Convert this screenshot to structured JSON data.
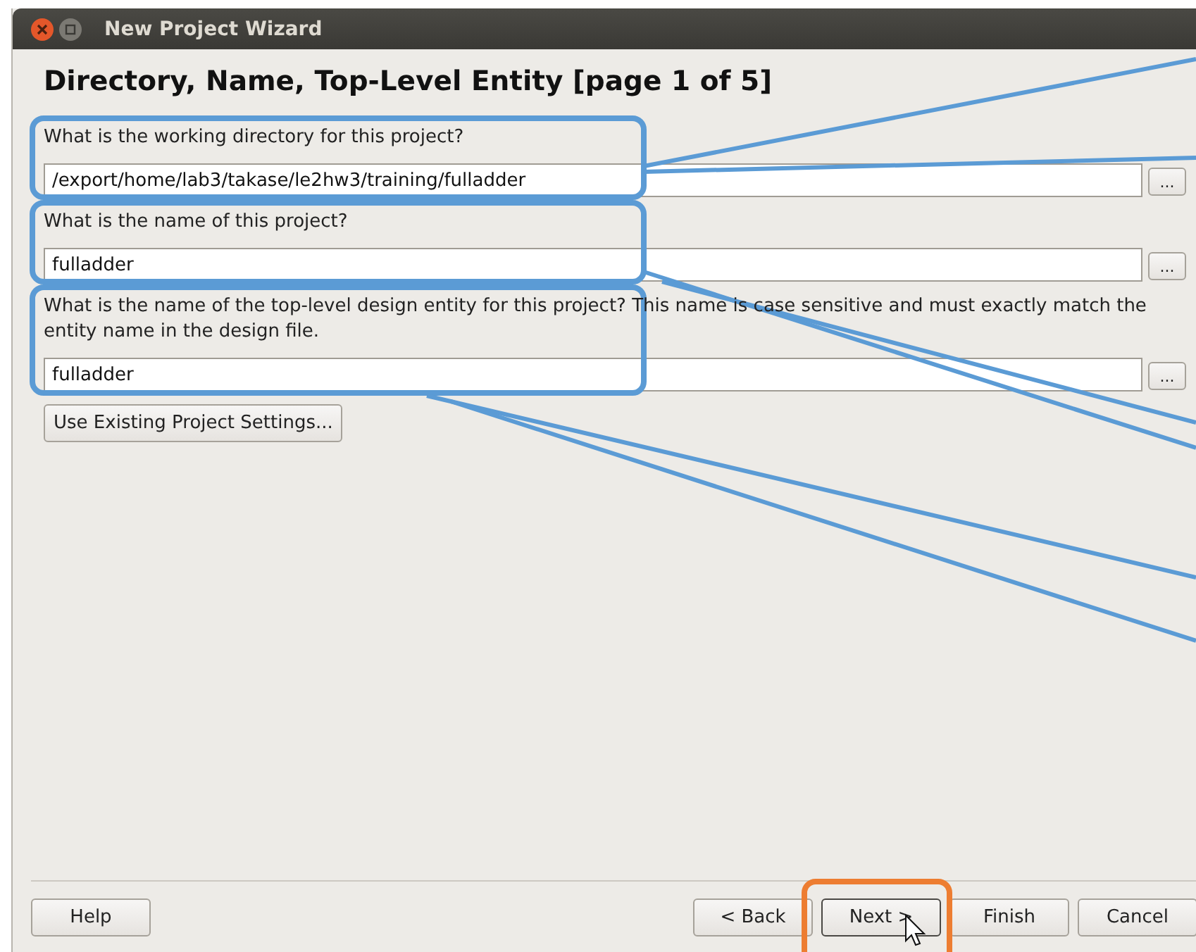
{
  "window": {
    "title": "New Project Wizard"
  },
  "heading": "Directory, Name, Top-Level Entity [page 1 of 5]",
  "fields": [
    {
      "label": "What is the working directory for this project?",
      "value": "/export/home/lab3/takase/le2hw3/training/fulladder",
      "browse": "..."
    },
    {
      "label": "What is the name of this project?",
      "value": "fulladder",
      "browse": "..."
    },
    {
      "label": "What is the name of the top-level design entity for this project? This name is case sensitive and must exactly match the entity name in the design file.",
      "value": "fulladder",
      "browse": "..."
    }
  ],
  "use_existing_button": "Use Existing Project Settings...",
  "help_button": "Help",
  "nav_buttons": [
    {
      "label": "< Back",
      "default": false
    },
    {
      "label": "Next >",
      "default": true
    },
    {
      "label": "Finish",
      "default": false
    },
    {
      "label": "Cancel",
      "default": false
    }
  ]
}
